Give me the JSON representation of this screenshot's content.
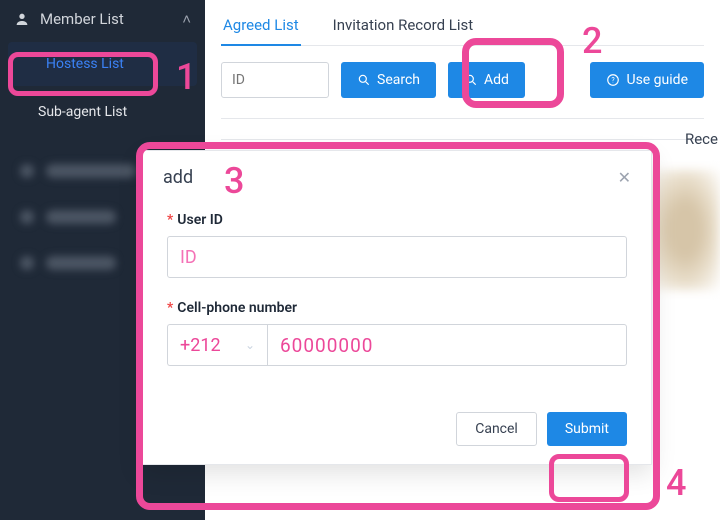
{
  "sidebar": {
    "header": "Member List",
    "items": [
      {
        "label": "Hostess List"
      },
      {
        "label": "Sub-agent List"
      }
    ]
  },
  "tabs": [
    {
      "label": "Agreed List",
      "active": true
    },
    {
      "label": "Invitation Record List",
      "active": false
    }
  ],
  "toolbar": {
    "id_placeholder": "ID",
    "search_label": "Search",
    "add_label": "Add",
    "guide_label": "Use guide"
  },
  "table": {
    "rece_label": "Rece"
  },
  "modal": {
    "title": "add",
    "user_id_label": "User ID",
    "user_id_placeholder": "ID",
    "user_id_value": "",
    "phone_label": "Cell-phone number",
    "phone_prefix": "+212",
    "phone_value": "60000000",
    "cancel_label": "Cancel",
    "submit_label": "Submit"
  },
  "annotations": {
    "n1": "1",
    "n2": "2",
    "n3": "3",
    "n4": "4"
  }
}
